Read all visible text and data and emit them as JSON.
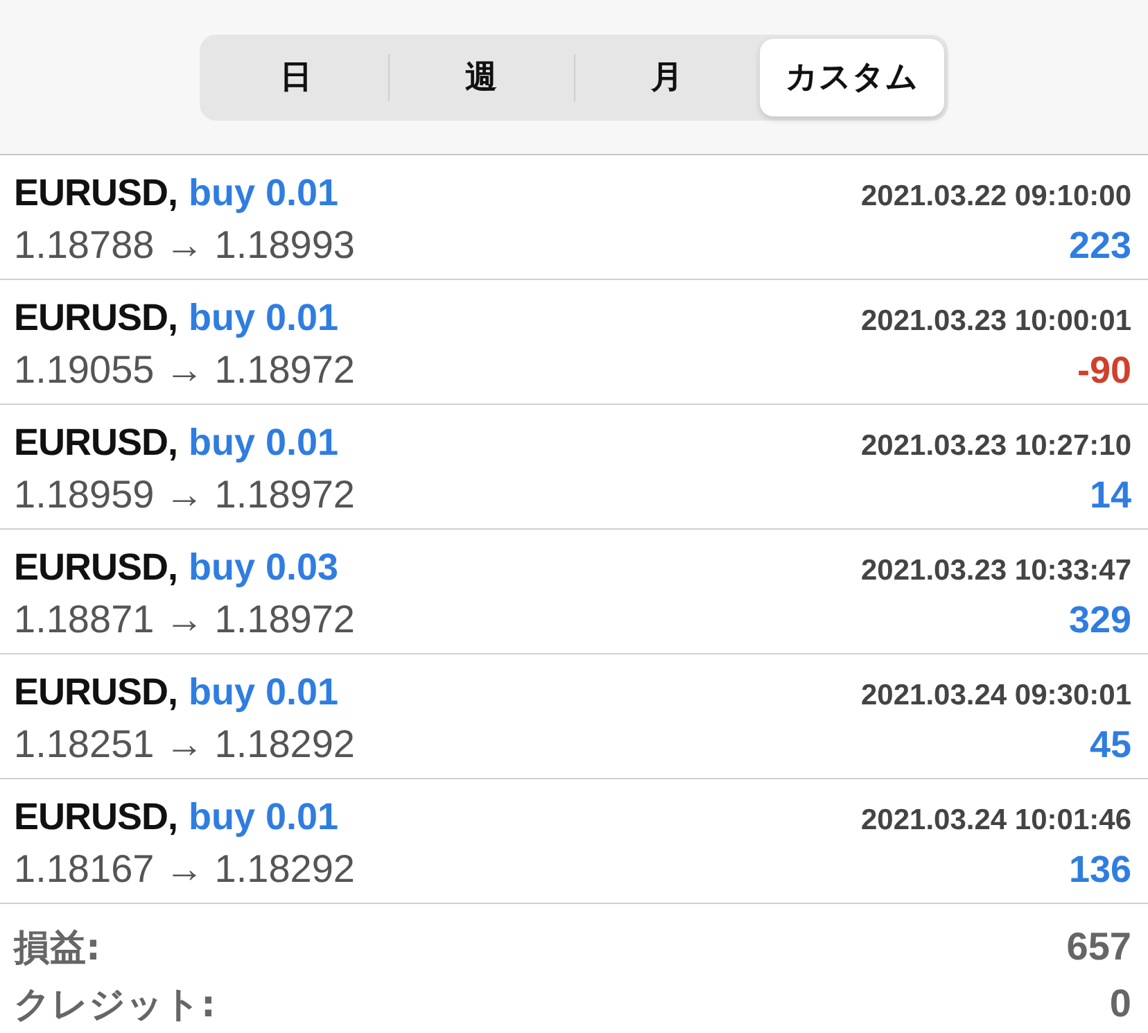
{
  "tabs": [
    {
      "label": "日",
      "selected": false
    },
    {
      "label": "週",
      "selected": false
    },
    {
      "label": "月",
      "selected": false
    },
    {
      "label": "カスタム",
      "selected": true
    }
  ],
  "trades": [
    {
      "symbol": "EURUSD,",
      "order": "buy 0.01",
      "time": "2021.03.22 09:10:00",
      "prices": "1.18788 → 1.18993",
      "profit": "223",
      "negative": false
    },
    {
      "symbol": "EURUSD,",
      "order": "buy 0.01",
      "time": "2021.03.23 10:00:01",
      "prices": "1.19055 → 1.18972",
      "profit": "-90",
      "negative": true
    },
    {
      "symbol": "EURUSD,",
      "order": "buy 0.01",
      "time": "2021.03.23 10:27:10",
      "prices": "1.18959 → 1.18972",
      "profit": "14",
      "negative": false
    },
    {
      "symbol": "EURUSD,",
      "order": "buy 0.03",
      "time": "2021.03.23 10:33:47",
      "prices": "1.18871 → 1.18972",
      "profit": "329",
      "negative": false
    },
    {
      "symbol": "EURUSD,",
      "order": "buy 0.01",
      "time": "2021.03.24 09:30:01",
      "prices": "1.18251 → 1.18292",
      "profit": "45",
      "negative": false
    },
    {
      "symbol": "EURUSD,",
      "order": "buy 0.01",
      "time": "2021.03.24 10:01:46",
      "prices": "1.18167 → 1.18292",
      "profit": "136",
      "negative": false
    }
  ],
  "summary": [
    {
      "label": "損益:",
      "value": "657"
    },
    {
      "label": "クレジット:",
      "value": "0"
    }
  ]
}
